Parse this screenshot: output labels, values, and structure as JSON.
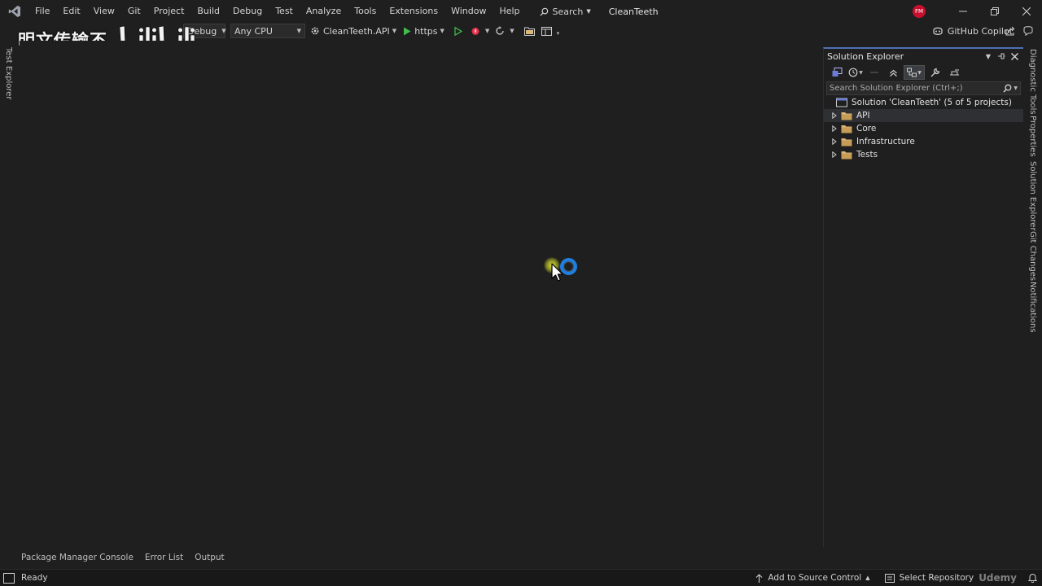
{
  "menubar": {
    "items": [
      "File",
      "Edit",
      "View",
      "Git",
      "Project",
      "Build",
      "Debug",
      "Test",
      "Analyze",
      "Tools",
      "Extensions",
      "Window",
      "Help"
    ],
    "search_label": "Search",
    "window_title": "CleanTeeth",
    "avatar_initials": "FM"
  },
  "toolbar": {
    "config_value": "Debug",
    "platform_value": "Any CPU",
    "startup_project": "CleanTeeth.API",
    "launch_profile": "https",
    "copilot_label": "GitHub Copilot"
  },
  "watermark": {
    "text": "明文传输不"
  },
  "left_tabs": {
    "test_explorer": "Test Explorer"
  },
  "solution_explorer": {
    "title": "Solution Explorer",
    "search_placeholder": "Search Solution Explorer (Ctrl+;)",
    "solution_label": "Solution 'CleanTeeth' (5 of 5 projects)",
    "folders": [
      "API",
      "Core",
      "Infrastructure",
      "Tests"
    ]
  },
  "right_tabs": {
    "diagnostic_tools": "Diagnostic Tools",
    "properties": "Properties",
    "solution_explorer": "Solution Explorer",
    "git_changes": "Git Changes",
    "notifications": "Notifications"
  },
  "bottom_tabs": {
    "package_manager": "Package Manager Console",
    "error_list": "Error List",
    "output": "Output"
  },
  "statusbar": {
    "status": "Ready",
    "source_control": "Add to Source Control",
    "repository": "Select Repository",
    "udemy": "Udemy"
  },
  "colors": {
    "background": "#1f1f1f",
    "accent_blue": "#4e6fb3",
    "folder": "#dcb67a",
    "run_green": "#3fbf4a"
  }
}
